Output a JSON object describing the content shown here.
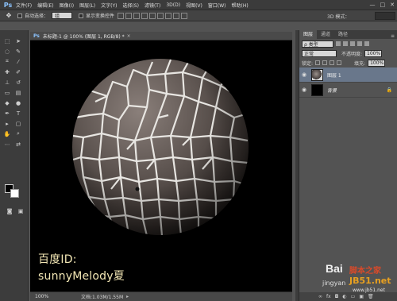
{
  "app": {
    "logo": "Ps"
  },
  "menu": [
    "文件(F)",
    "编辑(E)",
    "图像(I)",
    "图层(L)",
    "文字(Y)",
    "选择(S)",
    "滤镜(T)",
    "3D(D)",
    "视图(V)",
    "窗口(W)",
    "帮助(H)"
  ],
  "window_controls": [
    "—",
    "□",
    "✕"
  ],
  "options": {
    "tool_icon": "move-tool",
    "auto_select_label": "自动选择：",
    "auto_select_value": "组",
    "show_transform_label": "显示变换控件",
    "mode_3d": "3D 模式："
  },
  "document": {
    "tab_icon": "Ps",
    "title": "未标题-1 @ 100% (图层 1, RGB/8) *",
    "close": "×",
    "overlay_line1": "百度ID:",
    "overlay_line2": "sunnyMelody夏",
    "zoom": "100%",
    "doc_info": "文档:1.03M/1.55M",
    "status_arrow": "▸"
  },
  "layers_panel": {
    "tabs": [
      "图层",
      "通道",
      "路径"
    ],
    "menu": "≡",
    "kind_label": "ρ 类型",
    "blend_mode": "正常",
    "opacity_label": "不透明度:",
    "opacity_value": "100%",
    "lock_label": "锁定:",
    "fill_label": "填充:",
    "fill_value": "100%",
    "layers": [
      {
        "name": "图层 1",
        "selected": true
      },
      {
        "name": "背景",
        "selected": false,
        "locked": true
      }
    ],
    "footer": [
      "∞",
      "fx",
      "◘",
      "◐",
      "▭",
      "▣",
      "🗑"
    ]
  },
  "colors": {
    "canvas": "#000000",
    "selected_layer": "#69778b",
    "overlay_text": "#f2e6b4"
  },
  "site_watermark": {
    "line1": "Bai",
    "line2": "脚本之家",
    "line3": "jingyan",
    "line4": "JB51.net",
    "line5": "www.jb51.net"
  }
}
